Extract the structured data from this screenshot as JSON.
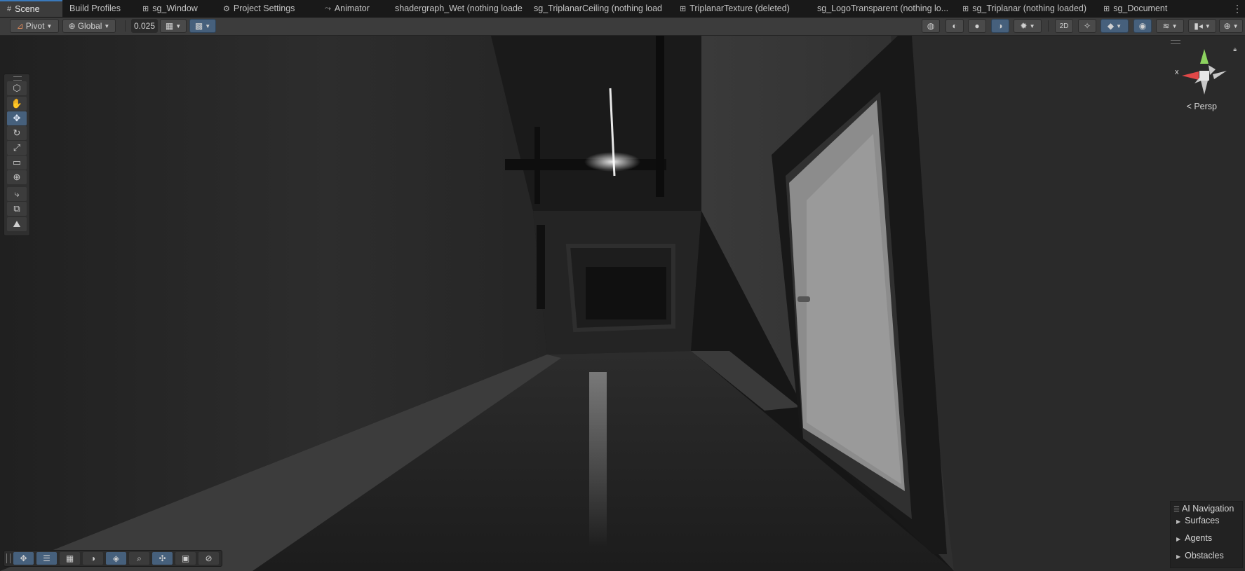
{
  "tabs": [
    {
      "label": "Scene",
      "icon": "grid-icon",
      "active": true
    },
    {
      "label": "Build Profiles",
      "icon": "",
      "active": false
    },
    {
      "label": "sg_Window",
      "icon": "shader-graph-icon",
      "active": false
    },
    {
      "label": "Project Settings",
      "icon": "gear-icon",
      "active": false
    },
    {
      "label": "Animator",
      "icon": "animator-icon",
      "active": false
    },
    {
      "label": "shadergraph_Wet (nothing loade",
      "icon": "",
      "active": false
    },
    {
      "label": "sg_TriplanarCeiling (nothing load",
      "icon": "",
      "active": false
    },
    {
      "label": "TriplanarTexture (deleted)",
      "icon": "shader-graph-icon",
      "active": false
    },
    {
      "label": "sg_LogoTransparent (nothing lo...",
      "icon": "",
      "active": false
    },
    {
      "label": "sg_Triplanar (nothing loaded)",
      "icon": "shader-graph-icon",
      "active": false
    },
    {
      "label": "sg_Document",
      "icon": "shader-graph-icon",
      "active": false
    }
  ],
  "toolbar": {
    "pivot_label": "Pivot",
    "global_label": "Global",
    "snap_value": "0.025"
  },
  "tools": [
    {
      "name": "view-tool-icon",
      "glyph": "⬡",
      "selected": false
    },
    {
      "name": "hand-tool-icon",
      "glyph": "✋",
      "selected": false
    },
    {
      "name": "move-tool-icon",
      "glyph": "✥",
      "selected": true
    },
    {
      "name": "rotate-tool-icon",
      "glyph": "↻",
      "selected": false
    },
    {
      "name": "scale-tool-icon",
      "glyph": "⤢",
      "selected": false
    },
    {
      "name": "rect-tool-icon",
      "glyph": "▭",
      "selected": false
    },
    {
      "name": "transform-tool-icon",
      "glyph": "⊕",
      "selected": false
    },
    {
      "name": "custom-tool-icon",
      "glyph": "⤷",
      "selected": false
    },
    {
      "name": "duplicate-tool-icon",
      "glyph": "⧉",
      "selected": false
    },
    {
      "name": "terrain-tool-icon",
      "glyph": "⛰",
      "selected": false
    }
  ],
  "gizmo": {
    "x_label": "x",
    "persp_label": "< Persp"
  },
  "bottom_tools": [
    {
      "name": "move-overlay-icon",
      "glyph": "✥",
      "blue": true
    },
    {
      "name": "sliders-icon",
      "glyph": "☰",
      "blue": true
    },
    {
      "name": "grid-icon",
      "glyph": "▦",
      "blue": false
    },
    {
      "name": "shading-icon",
      "glyph": "◑",
      "blue": false
    },
    {
      "name": "layers-icon",
      "glyph": "◈",
      "blue": true
    },
    {
      "name": "search-icon",
      "glyph": "⌕",
      "blue": false
    },
    {
      "name": "pivot-icon",
      "glyph": "✣",
      "blue": true
    },
    {
      "name": "camera-overlay-icon",
      "glyph": "▣",
      "blue": false
    },
    {
      "name": "compass-icon",
      "glyph": "⊘",
      "blue": false
    }
  ],
  "ai_navigation": {
    "title": "AI Navigation",
    "items": [
      "Surfaces",
      "Agents",
      "Obstacles"
    ]
  }
}
